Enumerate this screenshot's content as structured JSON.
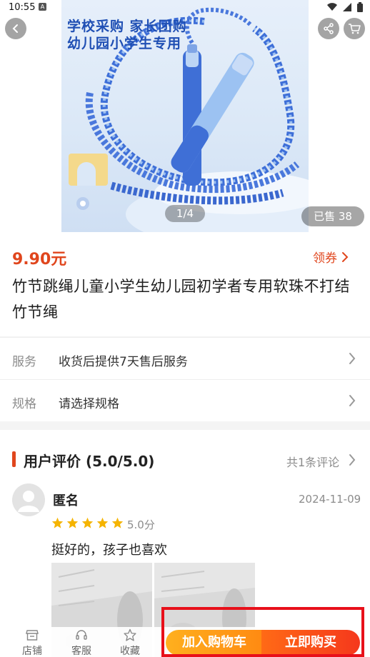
{
  "status_bar": {
    "time": "10:55",
    "notification_letter": "A"
  },
  "gallery": {
    "promo_line_1": "学校采购 家长团购",
    "promo_line_2": "幼儿园小学生专用",
    "counter": "1/4",
    "sold": "已售 38"
  },
  "product": {
    "price": "9.90元",
    "coupon_label": "领券",
    "title": "竹节跳绳儿童小学生幼儿园初学者专用软珠不打结竹节绳"
  },
  "rows": [
    {
      "key": "服务",
      "value": "收货后提供7天售后服务"
    },
    {
      "key": "规格",
      "value": "请选择规格"
    }
  ],
  "reviews": {
    "heading": "用户评价 (5.0/5.0)",
    "count_label": "共1条评论",
    "items": [
      {
        "user": "匿名",
        "date": "2024-11-09",
        "rating": 5,
        "score_label": "5.0分",
        "text": "挺好的，孩子也喜欢"
      }
    ]
  },
  "bottom_bar": {
    "tabs": [
      {
        "label": "店铺",
        "icon": "store-icon"
      },
      {
        "label": "客服",
        "icon": "headset-icon"
      },
      {
        "label": "收藏",
        "icon": "star-outline-icon"
      }
    ],
    "add_to_cart": "加入购物车",
    "buy_now": "立即购买"
  },
  "colors": {
    "accent": "#e0461d",
    "cart_button": "#ffa21a",
    "buy_button": "#f5481c",
    "highlight": "#e8101a"
  }
}
